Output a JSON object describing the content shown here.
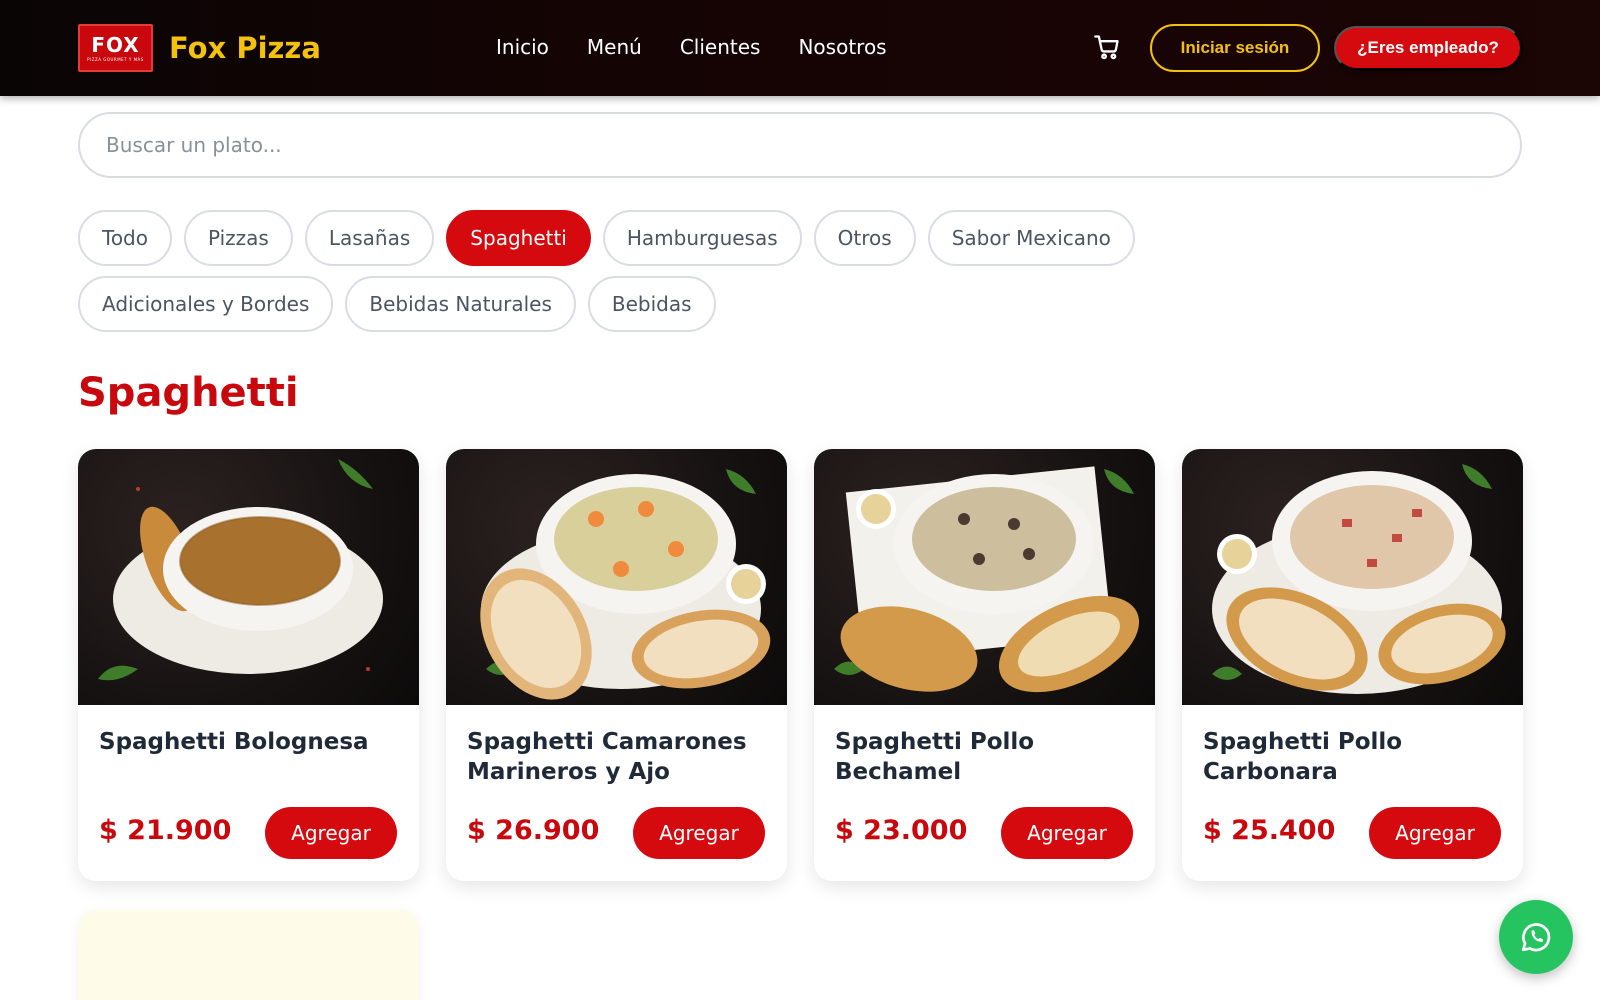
{
  "header": {
    "logo_text": "FOX",
    "logo_tagline": "PIZZA GOURMET Y MÁS",
    "brand_name": "Fox Pizza",
    "nav": [
      {
        "label": "Inicio"
      },
      {
        "label": "Menú"
      },
      {
        "label": "Clientes"
      },
      {
        "label": "Nosotros"
      }
    ],
    "cart_icon": "cart-icon",
    "login_label": "Iniciar sesión",
    "employee_label": "¿Eres empleado?"
  },
  "search": {
    "placeholder": "Buscar un plato...",
    "value": ""
  },
  "categories": [
    {
      "label": "Todo",
      "active": false
    },
    {
      "label": "Pizzas",
      "active": false
    },
    {
      "label": "Lasañas",
      "active": false
    },
    {
      "label": "Spaghetti",
      "active": true
    },
    {
      "label": "Hamburguesas",
      "active": false
    },
    {
      "label": "Otros",
      "active": false
    },
    {
      "label": "Sabor Mexicano",
      "active": false
    },
    {
      "label": "Adicionales y Bordes",
      "active": false
    },
    {
      "label": "Bebidas Naturales",
      "active": false
    },
    {
      "label": "Bebidas",
      "active": false
    }
  ],
  "section": {
    "title": "Spaghetti"
  },
  "products": [
    {
      "name": "Spaghetti Bolognesa",
      "price": "$ 21.900",
      "button": "Agregar",
      "image": "spaghetti-bolognesa-photo",
      "sauce": "#a8722e"
    },
    {
      "name": "Spaghetti Camarones Marineros y Ajo",
      "price": "$ 26.900",
      "button": "Agregar",
      "image": "spaghetti-camarones-photo",
      "sauce": "#d9cf9a"
    },
    {
      "name": "Spaghetti Pollo Bechamel",
      "price": "$ 23.000",
      "button": "Agregar",
      "image": "spaghetti-pollo-bechamel-photo",
      "sauce": "#cdbf9e"
    },
    {
      "name": "Spaghetti Pollo Carbonara",
      "price": "$ 25.400",
      "button": "Agregar",
      "image": "spaghetti-pollo-carbonara-photo",
      "sauce": "#e0c7aa"
    }
  ],
  "colors": {
    "brand_red": "#d40a0f",
    "brand_yellow": "#f4c20d",
    "whatsapp_green": "#25c460"
  },
  "fab": {
    "icon": "whatsapp-icon"
  }
}
